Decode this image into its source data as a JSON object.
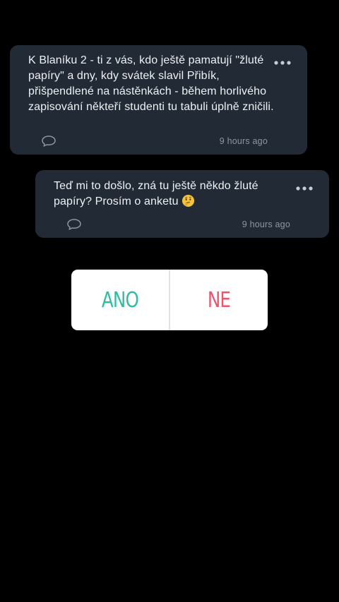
{
  "posts": [
    {
      "text": "K Blaníku 2 - ti z vás, kdo ještě pamatují \"žluté papíry\" a dny, kdy svátek slavil Přibík, přišpendlené na nástěnkách - během horlivého zapisování někteří studenti tu tabuli úplně zničili.",
      "timestamp": "9 hours ago",
      "icons": [
        "comment-icon",
        "more-options-icon"
      ]
    },
    {
      "text": "Teď mi to došlo, zná tu ještě někdo žluté papíry? Prosím o anketu",
      "emoji": "thinking-face-emoji",
      "timestamp": "9 hours ago",
      "icons": [
        "comment-icon",
        "more-options-icon"
      ]
    }
  ],
  "poll": {
    "yes_label": "ANO",
    "no_label": "NE",
    "colors": {
      "yes": "#2bbf9f",
      "no": "#ec5470",
      "background": "#ffffff"
    }
  },
  "colors": {
    "page_background": "#000000",
    "card_background": "#222a35",
    "text": "#eef1f5",
    "muted": "#8c96a3"
  }
}
